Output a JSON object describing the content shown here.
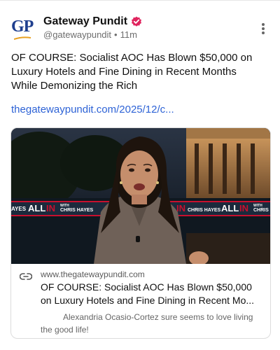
{
  "account": {
    "display_name": "Gateway Pundit",
    "handle": "@gatewaypundit",
    "time_ago": "11m",
    "avatar_text": "GP"
  },
  "post": {
    "text": "OF COURSE: Socialist AOC Has Blown $50,000 on Luxury Hotels and Fine Dining in Recent Months While Demonizing the Rich",
    "link_text": "thegatewaypundit.com/2025/12/c..."
  },
  "card": {
    "domain": "www.thegatewaypundit.com",
    "title": "OF COURSE: Socialist AOC Has Blown $50,000 on Luxury Hotels and Fine Dining in Recent Mo...",
    "description": "Alexandria Ocasio-Cortez sure seems to love living the good life!",
    "banner": {
      "left_partial": "AYES",
      "all": "ALL",
      "in": "IN",
      "with": "WITH",
      "host": "CHRIS HAYES",
      "right_partial": "CHRIS"
    }
  },
  "colors": {
    "verified_badge": "#e0245e",
    "link": "#2e63d6",
    "brand_navy": "#1f3f8e",
    "banner_red": "#c8102e"
  },
  "icons": {
    "verified": "verified-badge-icon",
    "more": "more-options-icon",
    "link": "link-icon"
  }
}
